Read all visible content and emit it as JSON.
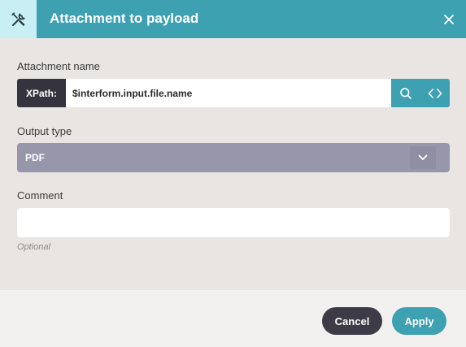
{
  "dialog": {
    "title": "Attachment to payload",
    "header_icon": "tools-icon",
    "close_icon": "close-icon"
  },
  "attachment_name": {
    "label": "Attachment name",
    "badge": "XPath:",
    "value": "$interform.input.file.name",
    "search_icon": "search-icon",
    "code_icon": "code-icon"
  },
  "output_type": {
    "label": "Output type",
    "selected": "PDF",
    "caret_icon": "chevron-down-icon"
  },
  "comment": {
    "label": "Comment",
    "value": "",
    "hint": "Optional"
  },
  "footer": {
    "cancel_label": "Cancel",
    "apply_label": "Apply"
  },
  "colors": {
    "accent": "#3da1b2",
    "header_icon_bg": "#c9eef3",
    "dark": "#35343e",
    "select_bg": "#9896ab",
    "panel_bg": "#e8e5e3"
  }
}
